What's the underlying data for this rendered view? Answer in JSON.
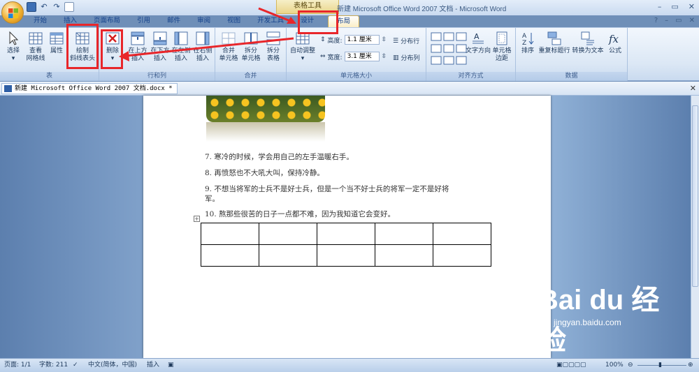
{
  "window": {
    "context_tools": "表格工具",
    "title": "新建 Microsoft Office Word 2007 文档 - Microsoft Word",
    "minimize": "–",
    "restore": "▭",
    "close": "✕"
  },
  "tabs": [
    "开始",
    "插入",
    "页面布局",
    "引用",
    "邮件",
    "审阅",
    "视图",
    "开发工具",
    "设计",
    "布局"
  ],
  "ribbon": {
    "table_group": {
      "label": "表",
      "select": "选择",
      "gridlines_1": "查看",
      "gridlines_2": "网格线",
      "properties": "属性"
    },
    "draw_diag": {
      "line1": "绘制",
      "line2": "斜线表头"
    },
    "rows_cols": {
      "label": "行和列",
      "delete": "删除",
      "insert_above_1": "在上方",
      "insert_above_2": "插入",
      "insert_below_1": "在下方",
      "insert_below_2": "插入",
      "insert_left_1": "在左侧",
      "insert_left_2": "插入",
      "insert_right_1": "在右侧",
      "insert_right_2": "插入"
    },
    "merge": {
      "label": "合并",
      "merge_1": "合并",
      "merge_2": "单元格",
      "split_cells_1": "拆分",
      "split_cells_2": "单元格",
      "split_table_1": "拆分",
      "split_table_2": "表格"
    },
    "cell_size": {
      "label": "单元格大小",
      "autofit": "自动调整",
      "height_label": "高度:",
      "height_value": "1.1 厘米",
      "width_label": "宽度:",
      "width_value": "3.1 厘米",
      "distribute_rows": "分布行",
      "distribute_cols": "分布列"
    },
    "alignment": {
      "label": "对齐方式",
      "text_direction": "文字方向",
      "cell_margins_1": "单元格",
      "cell_margins_2": "边距"
    },
    "data": {
      "label": "数据",
      "sort": "排序",
      "repeat_header": "重复标题行",
      "convert": "转换为文本",
      "formula": "公式"
    }
  },
  "document": {
    "tab_title": "新建 Microsoft Office Word 2007 文档.docx *",
    "lines": [
      "7.   寒冷的时候，学会用自己的左手温暖右手。",
      "8.   再愤怒也不大吼大叫，保持冷静。",
      "9.   不想当将军的士兵不是好士兵，但是一个当不好士兵的将军一定不是好将",
      "军。",
      "10.   熬那些很苦的日子一点都不难，因为我知道它会变好。"
    ],
    "table": {
      "rows": 2,
      "cols": 5
    }
  },
  "status": {
    "page": "页面: 1/1",
    "words": "字数: 211",
    "language": "中文(简体，中国)",
    "mode": "插入",
    "zoom": "100%"
  },
  "watermark": {
    "brand": "Bai du 经验",
    "url": "jingyan.baidu.com"
  },
  "colors": {
    "highlight": "#e8262a",
    "accent": "#15428b"
  }
}
